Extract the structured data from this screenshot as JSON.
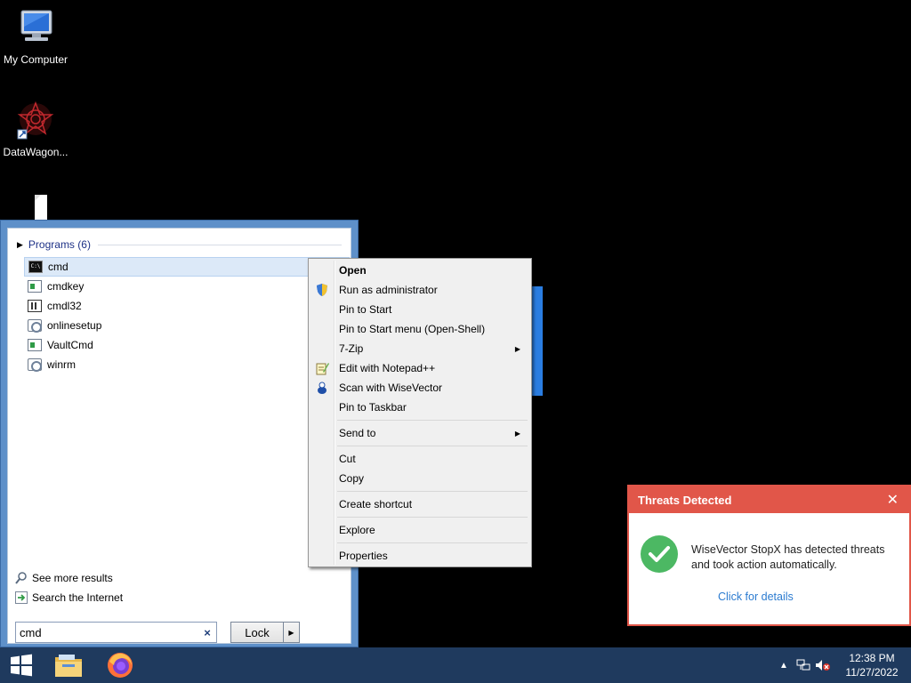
{
  "desktop": {
    "icons": [
      {
        "label": "My Computer"
      },
      {
        "label": "DataWagon..."
      },
      {
        "label": ""
      }
    ]
  },
  "start_menu": {
    "programs_header": "Programs (6)",
    "programs": [
      {
        "label": "cmd",
        "icon": "console-icon",
        "selected": true
      },
      {
        "label": "cmdkey",
        "icon": "window-icon"
      },
      {
        "label": "cmdl32",
        "icon": "cmdl-icon"
      },
      {
        "label": "onlinesetup",
        "icon": "gear-icon"
      },
      {
        "label": "VaultCmd",
        "icon": "window-icon"
      },
      {
        "label": "winrm",
        "icon": "gear-icon"
      }
    ],
    "see_more": "See more results",
    "search_internet": "Search the Internet",
    "search_value": "cmd",
    "clear_glyph": "×",
    "lock_label": "Lock"
  },
  "context_menu": {
    "items": [
      {
        "label": "Open",
        "bold": true
      },
      {
        "label": "Run as administrator",
        "icon": "shield-icon"
      },
      {
        "label": "Pin to Start"
      },
      {
        "label": "Pin to Start menu (Open-Shell)"
      },
      {
        "label": "7-Zip",
        "submenu": true
      },
      {
        "label": "Edit with Notepad++",
        "icon": "notepad-icon"
      },
      {
        "label": "Scan with WiseVector",
        "icon": "wisevector-icon"
      },
      {
        "label": "Pin to Taskbar"
      },
      {
        "label": "Send to",
        "submenu": true
      },
      {
        "label": "Cut"
      },
      {
        "label": "Copy"
      },
      {
        "label": "Create shortcut"
      },
      {
        "label": "Explore"
      },
      {
        "label": "Properties"
      }
    ]
  },
  "notification": {
    "title": "Threats Detected",
    "message": "WiseVector StopX has detected threats and took action automatically.",
    "link": "Click for details",
    "accent": "#e15649"
  },
  "taskbar": {
    "time": "12:38 PM",
    "date": "11/27/2022",
    "color": "#1f3a5e"
  }
}
